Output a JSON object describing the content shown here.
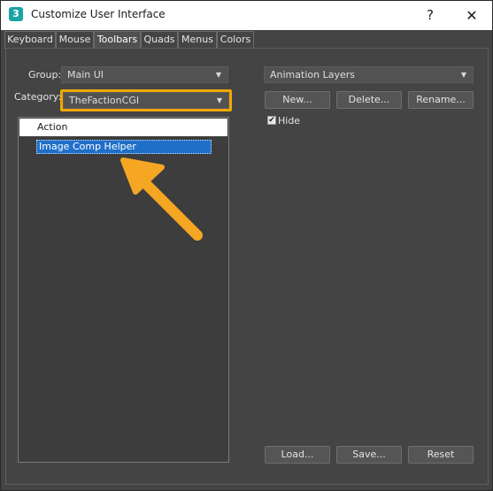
{
  "window": {
    "title": "Customize User Interface",
    "app_icon_glyph": "3",
    "help_glyph": "?",
    "close_glyph": "✕"
  },
  "tabs": [
    {
      "label": "Keyboard"
    },
    {
      "label": "Mouse"
    },
    {
      "label": "Toolbars"
    },
    {
      "label": "Quads"
    },
    {
      "label": "Menus"
    },
    {
      "label": "Colors"
    }
  ],
  "active_tab": "Toolbars",
  "left": {
    "group_label": "Group:",
    "group_value": "Main UI",
    "category_label": "Category:",
    "category_value": "TheFactionCGI",
    "list_header": "Action",
    "list_items": [
      "Image Comp Helper"
    ]
  },
  "right": {
    "toolbar_value": "Animation Layers",
    "new_label": "New...",
    "delete_label": "Delete...",
    "rename_label": "Rename...",
    "hide_label": "Hide",
    "hide_checked": true,
    "load_label": "Load...",
    "save_label": "Save...",
    "reset_label": "Reset"
  },
  "glyphs": {
    "dropdown_arrow": "▼",
    "check": "✔"
  },
  "colors": {
    "highlight": "#f0a800",
    "arrow": "#f5a623",
    "selection": "#1f6fc8"
  }
}
